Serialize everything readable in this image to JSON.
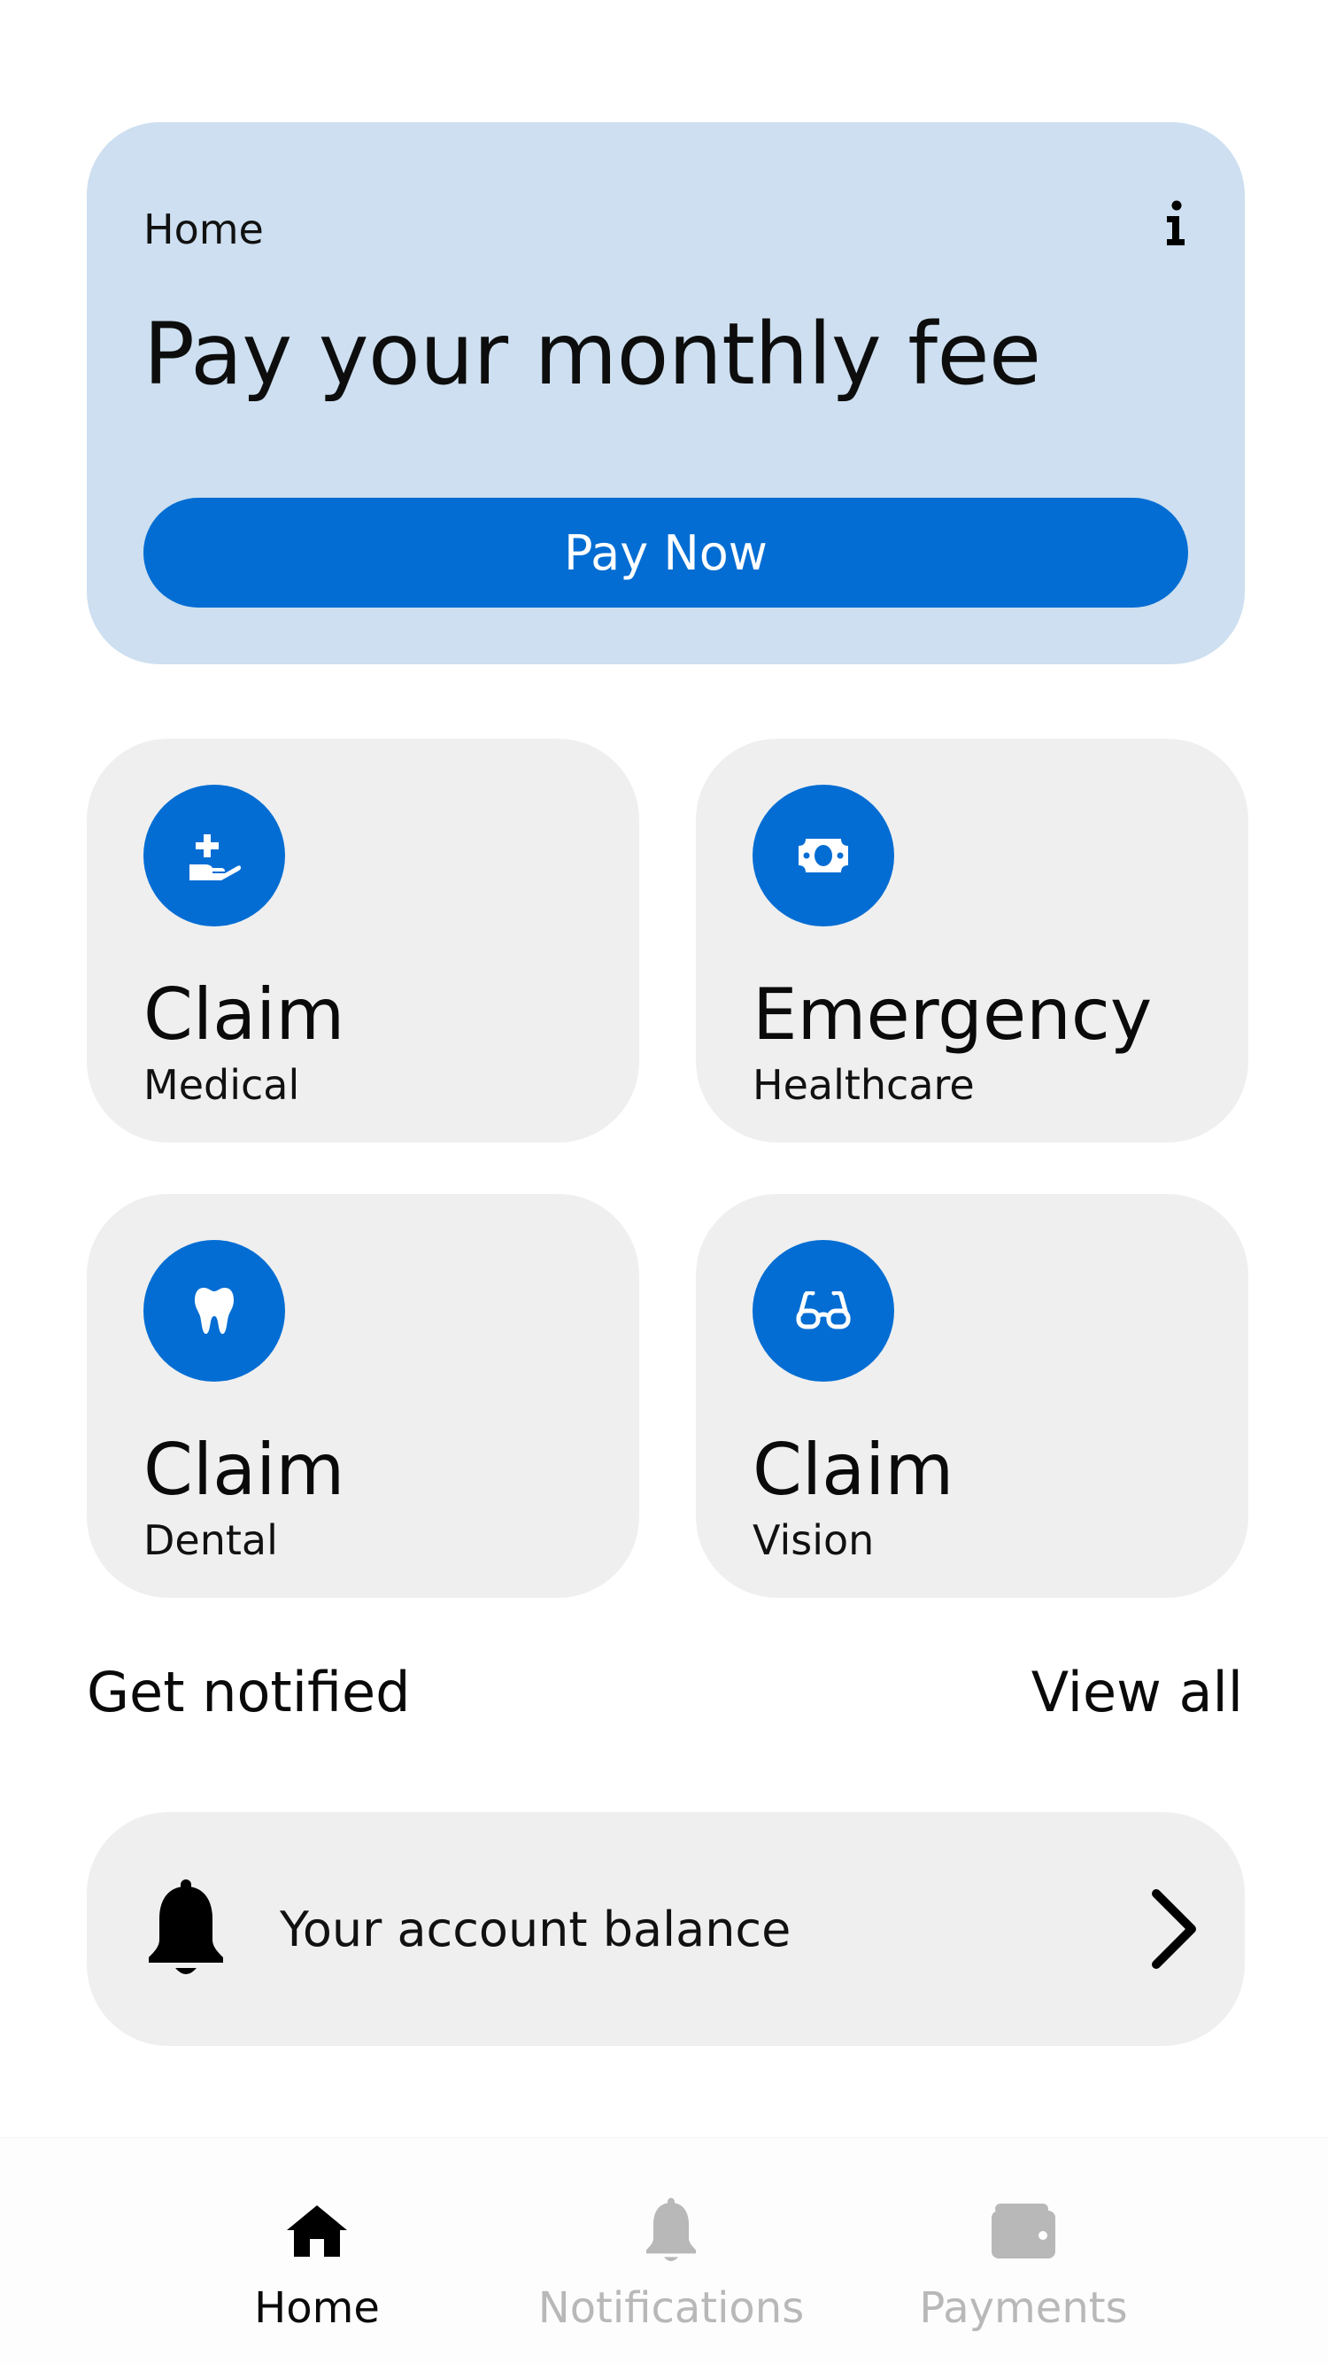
{
  "colors": {
    "primary": "#036dd3",
    "hero_bg": "#cddff0",
    "tile_bg": "#efefef",
    "inactive": "#b8b8b8"
  },
  "hero": {
    "breadcrumb": "Home",
    "info_icon": "info-icon",
    "title": "Pay your monthly fee",
    "button_label": "Pay Now"
  },
  "tiles": [
    {
      "icon": "hand-medical-icon",
      "title": "Claim",
      "subtitle": "Medical"
    },
    {
      "icon": "money-bill-icon",
      "title": "Emergency",
      "subtitle": "Healthcare"
    },
    {
      "icon": "tooth-icon",
      "title": "Claim",
      "subtitle": "Dental"
    },
    {
      "icon": "glasses-icon",
      "title": "Claim",
      "subtitle": "Vision"
    }
  ],
  "notifications": {
    "section_title": "Get notified",
    "view_all_label": "View all",
    "items": [
      {
        "icon": "bell-icon",
        "text": "Your account balance"
      }
    ]
  },
  "bottom_nav": {
    "items": [
      {
        "label": "Home",
        "icon": "home-icon",
        "active": true
      },
      {
        "label": "Notifications",
        "icon": "bell-icon",
        "active": false
      },
      {
        "label": "Payments",
        "icon": "wallet-icon",
        "active": false
      }
    ]
  }
}
